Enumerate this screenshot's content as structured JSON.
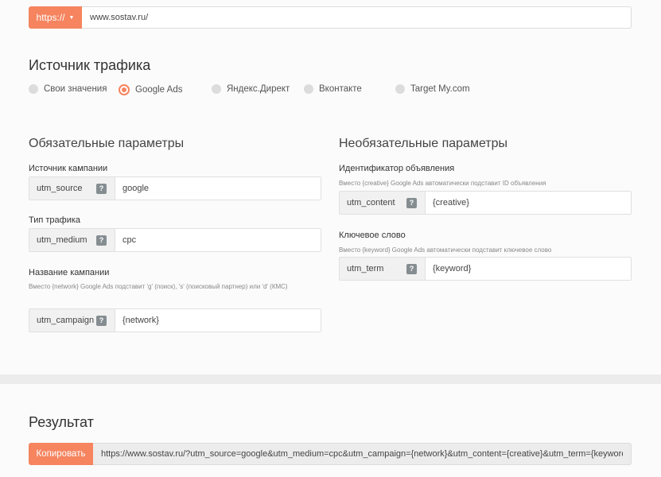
{
  "url_bar": {
    "protocol_label": "https://",
    "url_value": "www.sostav.ru/"
  },
  "traffic_source": {
    "title": "Источник трафика",
    "options": [
      {
        "label": "Свои значения",
        "selected": false
      },
      {
        "label": "Google Ads",
        "selected": true
      },
      {
        "label": "Яндекс.Директ",
        "selected": false
      },
      {
        "label": "Вконтакте",
        "selected": false
      },
      {
        "label": "Target My.com",
        "selected": false
      }
    ]
  },
  "required": {
    "title": "Обязательные параметры",
    "fields": [
      {
        "label": "Источник кампании",
        "hint": "",
        "key": "utm_source",
        "value": "google"
      },
      {
        "label": "Тип трафика",
        "hint": "",
        "key": "utm_medium",
        "value": "cpc"
      },
      {
        "label": "Название кампании",
        "hint": "Вместо {network} Google Ads подставит 'g' (поиск), 's' (поисковый партнер) или 'd' (КМС)",
        "key": "utm_campaign",
        "value": "{network}"
      }
    ]
  },
  "optional": {
    "title": "Необязательные параметры",
    "fields": [
      {
        "label": "Идентификатор объявления",
        "hint": "Вместо {creative} Google Ads автоматически подставит ID объявления",
        "key": "utm_content",
        "value": "{creative}"
      },
      {
        "label": "Ключевое слово",
        "hint": "Вместо {keyword} Google Ads автоматически подставит ключевое слово",
        "key": "utm_term",
        "value": "{keyword}"
      }
    ]
  },
  "help_icon": "?",
  "result": {
    "title": "Результат",
    "copy_label": "Копировать",
    "url": "https://www.sostav.ru/?utm_source=google&utm_medium=cpc&utm_campaign={network}&utm_content={creative}&utm_term={keyword}"
  },
  "colors": {
    "accent": "#f5845f",
    "key_bg": "#f1f1f1",
    "help_icon_bg": "#858d91"
  }
}
